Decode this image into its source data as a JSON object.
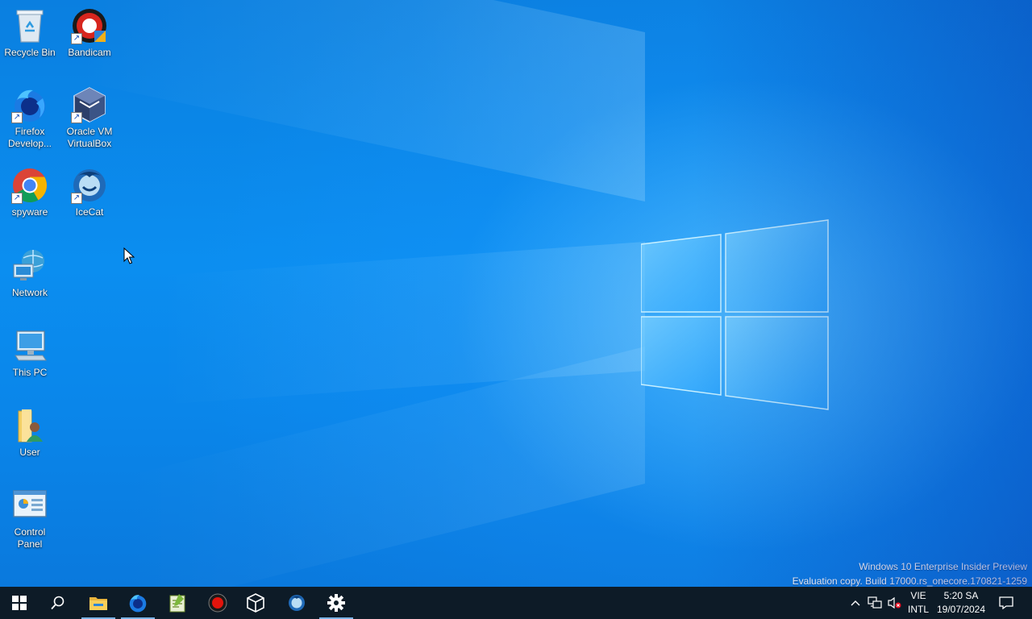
{
  "desktop": {
    "icons": [
      {
        "label": "Recycle Bin",
        "icon": "recycle-bin-icon"
      },
      {
        "label": "Bandicam",
        "icon": "bandicam-icon"
      },
      {
        "label": "Firefox\nDevelop...",
        "icon": "firefox-developer-icon"
      },
      {
        "label": "Oracle VM\nVirtualBox",
        "icon": "virtualbox-icon"
      },
      {
        "label": "spyware",
        "icon": "chrome-icon"
      },
      {
        "label": "IceCat",
        "icon": "icecat-icon"
      },
      {
        "label": "Network",
        "icon": "network-icon"
      },
      {
        "label": "This PC",
        "icon": "this-pc-icon"
      },
      {
        "label": "User",
        "icon": "user-folder-icon"
      },
      {
        "label": "Control\nPanel",
        "icon": "control-panel-icon"
      }
    ]
  },
  "watermark": {
    "line1": "Windows 10 Enterprise Insider Preview",
    "line2": "Evaluation copy. Build 17000.rs_onecore.170821-1259"
  },
  "taskbar": {
    "pinned": [
      "start-icon",
      "search-icon",
      "file-explorer-icon",
      "firefox-developer-icon",
      "notepad-plus-icon",
      "bandicam-icon",
      "virtualbox-icon",
      "icecat-icon",
      "settings-icon"
    ],
    "tray": {
      "lang_line1": "VIE",
      "lang_line2": "INTL",
      "time": "5:20 SA",
      "date": "19/07/2024"
    }
  },
  "colors": {
    "desktop_blue": "#0b8ef0",
    "taskbar": "#0d1b27",
    "active_indicator": "#7ab3e6"
  }
}
